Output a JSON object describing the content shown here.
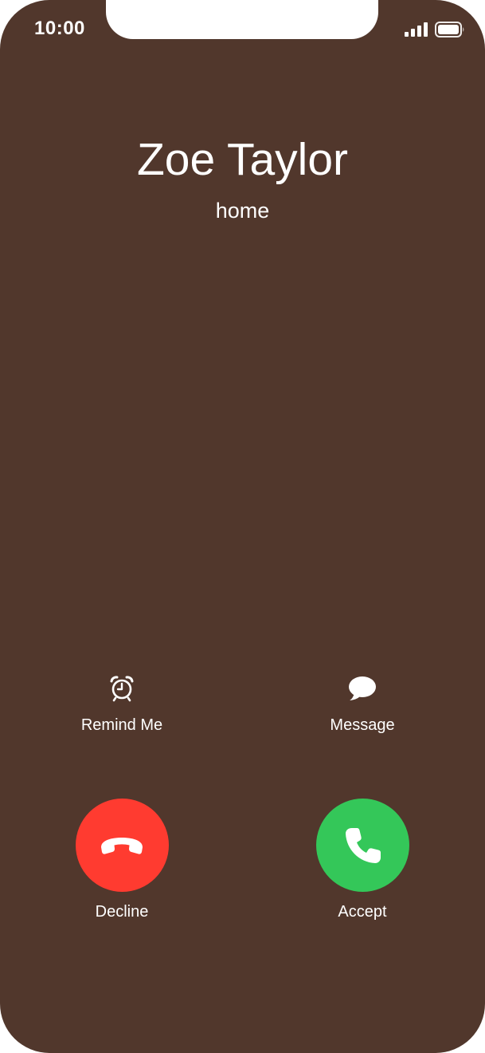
{
  "status_bar": {
    "time": "10:00",
    "signal_icon": "cellular-signal-icon",
    "battery_icon": "battery-icon"
  },
  "caller": {
    "name": "Zoe Taylor",
    "label": "home"
  },
  "actions": {
    "remind": {
      "label": "Remind Me",
      "icon": "alarm-clock-icon"
    },
    "message": {
      "label": "Message",
      "icon": "message-bubble-icon"
    }
  },
  "buttons": {
    "decline": {
      "label": "Decline",
      "icon": "hang-up-icon",
      "color": "#ff3b30"
    },
    "accept": {
      "label": "Accept",
      "icon": "phone-icon",
      "color": "#34c759"
    }
  },
  "colors": {
    "background": "#51372c",
    "text": "#ffffff"
  }
}
